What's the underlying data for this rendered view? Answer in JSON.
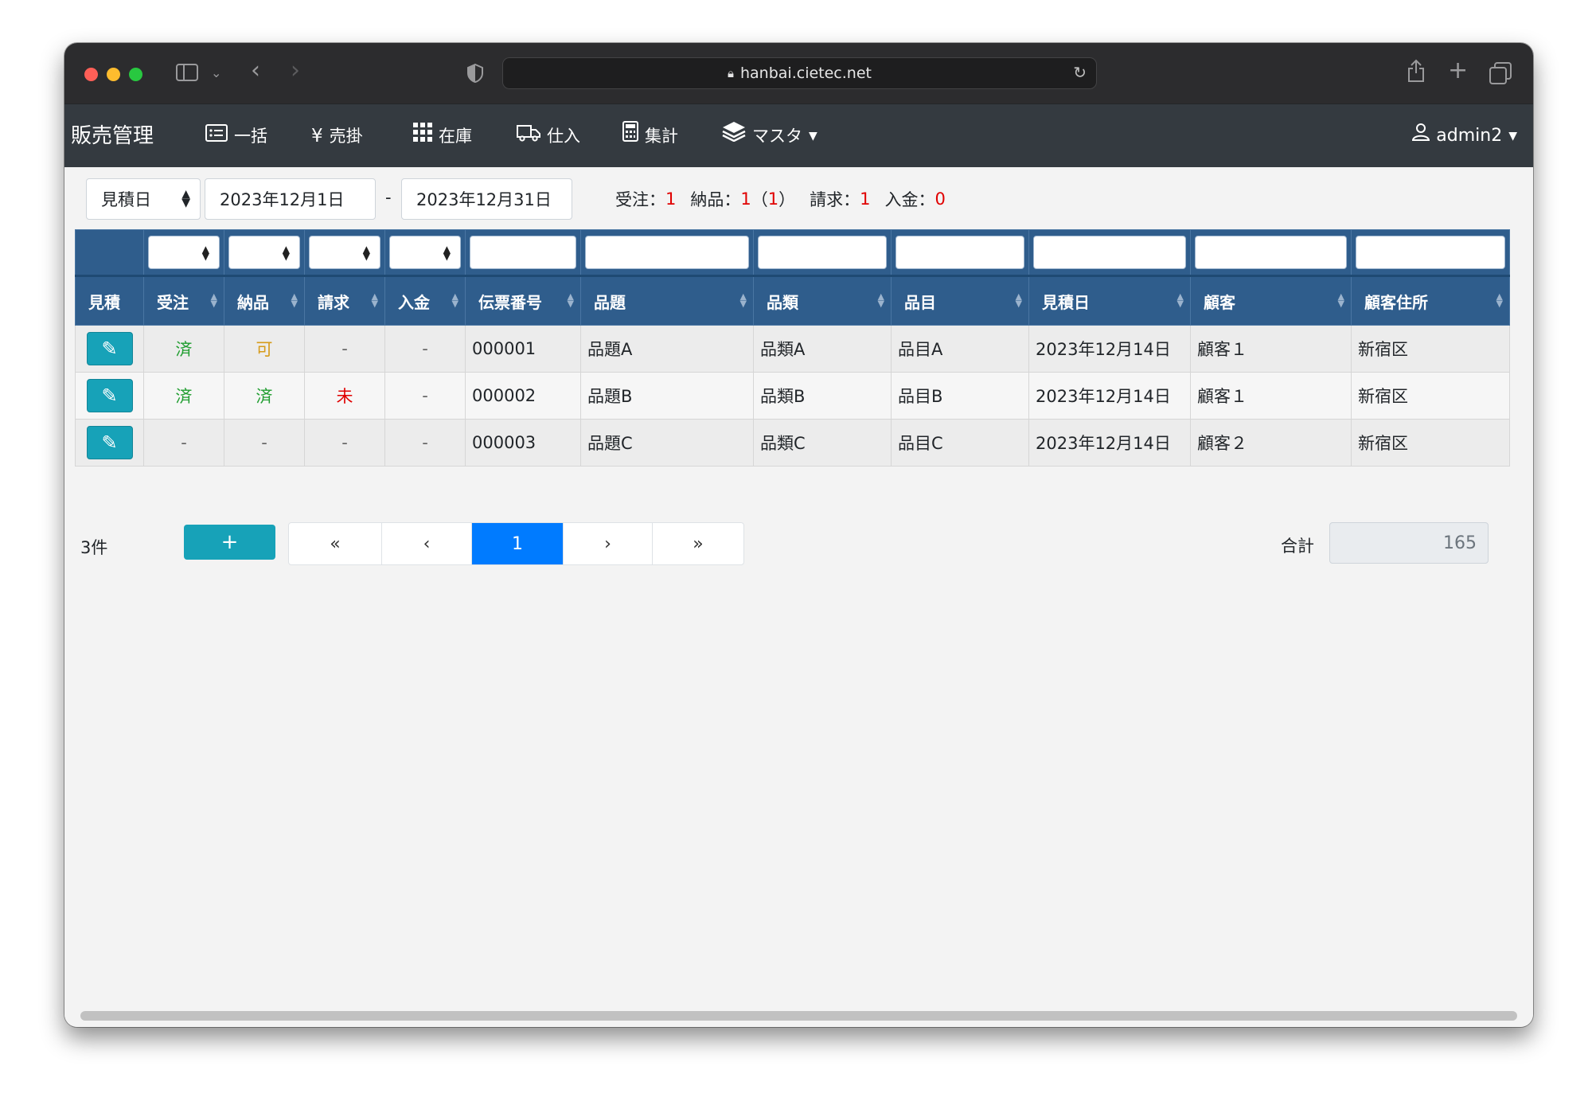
{
  "browser": {
    "url": "hanbai.cietec.net",
    "icons": [
      "sidebar-icon",
      "chevron-down-icon",
      "back-icon",
      "forward-icon",
      "shield-icon",
      "lock-icon",
      "reload-icon",
      "share-icon",
      "new-tab-icon",
      "tabs-icon"
    ]
  },
  "navbar": {
    "brand": "販売管理",
    "items": [
      {
        "label": "一括",
        "icon": "card-list-icon"
      },
      {
        "label": "売掛",
        "icon": "yen-icon"
      },
      {
        "label": "在庫",
        "icon": "grid-icon"
      },
      {
        "label": "仕入",
        "icon": "truck-icon"
      },
      {
        "label": "集計",
        "icon": "calculator-icon"
      },
      {
        "label": "マスタ",
        "icon": "layers-icon"
      }
    ],
    "user": "admin2"
  },
  "filters": {
    "date_type": "見積日",
    "date_from": "2023年12月1日",
    "separator": "-",
    "date_to": "2023年12月31日"
  },
  "summary": {
    "order_label": "受注：",
    "order_value": "1",
    "delivery_label": "納品：",
    "delivery_value": "1",
    "delivery_paren_open": "（",
    "delivery_paren_value": "1",
    "delivery_paren_close": "）",
    "invoice_label": "請求：",
    "invoice_value": "1",
    "payment_label": "入金：",
    "payment_value": "0"
  },
  "table": {
    "headers": [
      "見積",
      "受注",
      "納品",
      "請求",
      "入金",
      "伝票番号",
      "品題",
      "品類",
      "品目",
      "見積日",
      "顧客",
      "顧客住所"
    ],
    "rows": [
      {
        "order": "済",
        "delivery": "可",
        "invoice": "-",
        "payment": "-",
        "slip": "000001",
        "title": "品題A",
        "kind": "品類A",
        "item": "品目A",
        "date": "2023年12月14日",
        "customer": "顧客１",
        "address": "新宿区"
      },
      {
        "order": "済",
        "delivery": "済",
        "invoice": "未",
        "payment": "-",
        "slip": "000002",
        "title": "品題B",
        "kind": "品類B",
        "item": "品目B",
        "date": "2023年12月14日",
        "customer": "顧客１",
        "address": "新宿区"
      },
      {
        "order": "-",
        "delivery": "-",
        "invoice": "-",
        "payment": "-",
        "slip": "000003",
        "title": "品題C",
        "kind": "品類C",
        "item": "品目C",
        "date": "2023年12月14日",
        "customer": "顧客２",
        "address": "新宿区"
      }
    ]
  },
  "footer": {
    "count": "3件",
    "add_label": "+",
    "pager": [
      "«",
      "‹",
      "1",
      "›",
      "»"
    ],
    "total_label": "合計",
    "total_value": "165"
  },
  "colors": {
    "navbar": "#343a40",
    "table_header": "#2f5d8c",
    "accent": "#17a2b8",
    "active_page": "#007bff",
    "status_done": "#1f9d2f",
    "status_ok": "#d69b1a",
    "status_pending": "#e00000"
  }
}
